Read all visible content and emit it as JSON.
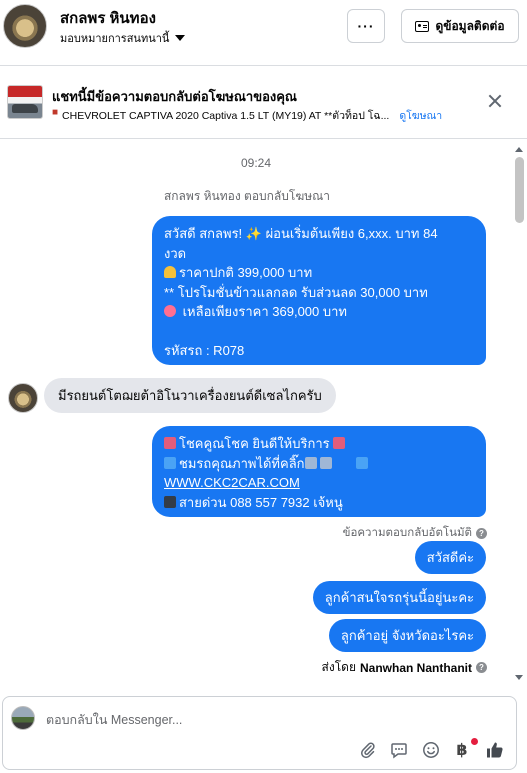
{
  "header": {
    "user_name": "สกลพร หินทอง",
    "assign_label": "มอบหมายการสนทนานี้",
    "more_label": "···",
    "contact_label": "ดูข้อมูลติดต่อ"
  },
  "ad": {
    "title": "แชทนี้มีข้อความตอบกลับต่อโฆษณาของคุณ",
    "subtitle": "CHEVROLET CAPTIVA 2020 Captiva 1.5 LT (MY19) AT **ตัวท็อป โฉ...",
    "link": "ดูโฆษณา"
  },
  "chat": {
    "time": "09:24",
    "system_note": "สกลพร หินทอง ตอบกลับโฆษณา",
    "bubble1": {
      "line1": "สวัสดี สกลพร! ✨  ผ่อนเริ่มต้นเพียง 6,xxx. บาท 84",
      "line2": "งวด",
      "line3": "ราคาปกติ 399,000 บาท",
      "line4": "** โปรโมชั่นข้าวแลกลด รับส่วนลด 30,000 บาท",
      "line5": " เหลือเพียงราคา 369,000 บาท",
      "line6": "",
      "line7": "รหัสรถ : R078"
    },
    "incoming": "มีรถยนต์โตฌยต้าอิโนวาเครื่องยนต์ดีเซลไกครับ",
    "bubble2": {
      "line1": "โชคคูณโชค ยินดีให้บริการ",
      "line2": "ชมรถคุณภาพได้ที่คลิ๊ก",
      "line3": "WWW.CKC2CAR.COM",
      "line4": "สายด่วน 088 557 7932 เจ้หนู"
    },
    "auto_reply_note": "ข้อความตอบกลับอัตโนมัติ",
    "replies": [
      "สวัสดีค่ะ",
      "ลูกค้าสนใจรถรุ่นนี้อยู่นะคะ",
      "ลูกค้าอยู่ จังหวัดอะไรคะ"
    ],
    "sent_by_prefix": "ส่งโดย",
    "sent_by_name": "Nanwhan Nanthanit"
  },
  "composer": {
    "placeholder": "ตอบกลับใน Messenger...",
    "baht_symbol": "฿"
  },
  "colors": {
    "accent": "#1877f2",
    "incoming_bubble": "#e4e6eb",
    "notification_dot": "#e41e3f"
  },
  "icons": [
    "more-icon",
    "contact-card-icon",
    "close-icon",
    "info-icon",
    "attach-icon",
    "saved-replies-icon",
    "emoji-icon",
    "baht-icon",
    "like-icon"
  ]
}
